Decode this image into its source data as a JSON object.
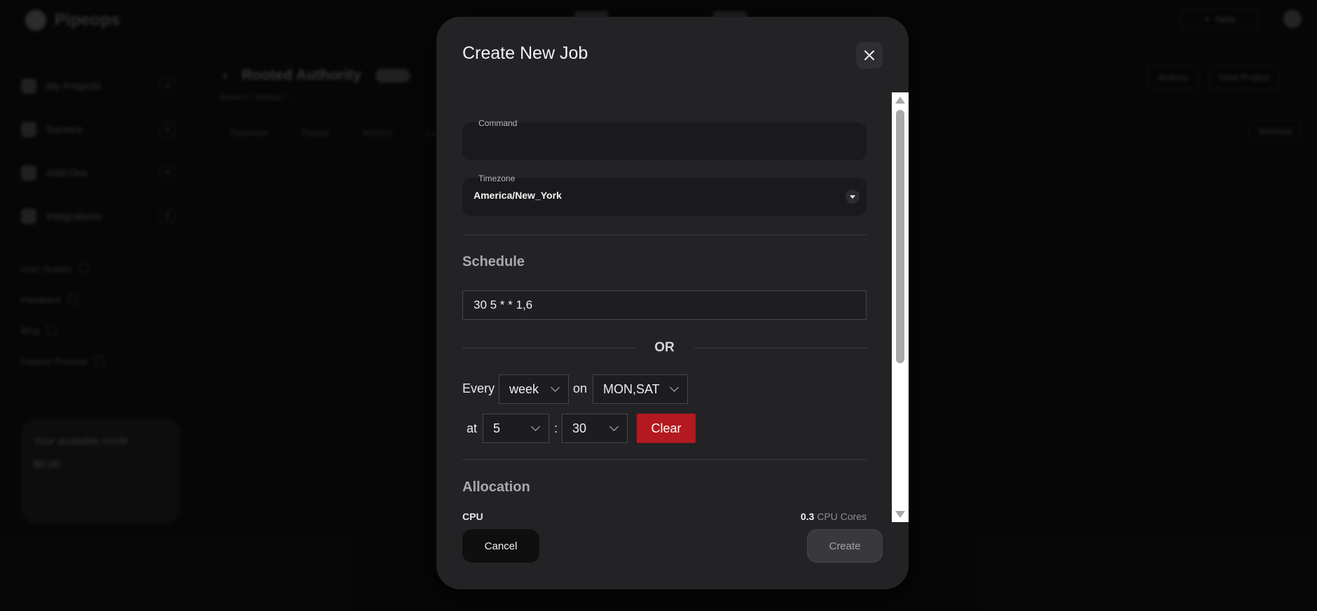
{
  "background": {
    "brand": "Pipeops",
    "new_button": "New",
    "sidebar": [
      {
        "label": "My Projects",
        "count": "0"
      },
      {
        "label": "Servers",
        "count": "0"
      },
      {
        "label": "Add-Ons",
        "count": "0"
      },
      {
        "label": "Integrations",
        "count": "0"
      }
    ],
    "links": [
      "User Guides",
      "Feedback",
      "Blog",
      "Feature Preview"
    ],
    "credit_title": "Your available credit",
    "credit_value": "$0.00",
    "project_title": "Rooted Authority",
    "breadcrumb": "Servers / Default / ...",
    "tabs": [
      "Overview",
      "Deploy",
      "Metrics",
      "Logs"
    ],
    "actions": [
      "Actions",
      "View Project"
    ],
    "terminal": "Terminal"
  },
  "modal": {
    "title": "Create New Job",
    "command": {
      "label": "Command",
      "value": ""
    },
    "timezone": {
      "label": "Timezone",
      "value": "America/New_York"
    },
    "schedule_title": "Schedule",
    "cron_value": "30 5 * * 1,6",
    "or_label": "OR",
    "every_label": "Every",
    "frequency": "week",
    "on_label": "on",
    "days": "MON,SAT",
    "at_label": "at",
    "hour": "5",
    "colon": ":",
    "minute": "30",
    "clear_label": "Clear",
    "allocation_title": "Allocation",
    "cpu_label": "CPU",
    "cpu_value": "0.3",
    "cpu_unit": "CPU Cores",
    "cancel_label": "Cancel",
    "create_label": "Create"
  },
  "colors": {
    "modal_bg": "#232326",
    "clear_button": "#b3191f",
    "overlay": "#0a0a0b"
  }
}
